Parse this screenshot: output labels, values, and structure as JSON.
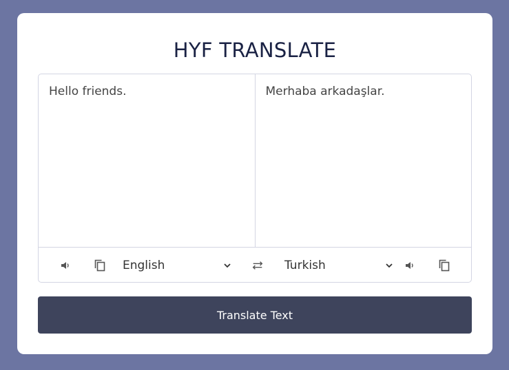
{
  "app": {
    "title": "HYF TRANSLATE"
  },
  "from": {
    "text": "Hello friends.",
    "language": "English"
  },
  "to": {
    "text": "Merhaba arkadaşlar.",
    "language": "Turkish"
  },
  "actions": {
    "translate_label": "Translate Text"
  },
  "icons": {
    "from_speak": "volume-icon",
    "from_copy": "copy-icon",
    "exchange": "exchange-icon",
    "to_speak": "volume-icon",
    "to_copy": "copy-icon",
    "select_arrow": "chevron-down-icon"
  },
  "colors": {
    "background": "#6c75a2",
    "card": "#ffffff",
    "title": "#1a2244",
    "button": "#3e445c",
    "border": "#d3d5e3"
  }
}
